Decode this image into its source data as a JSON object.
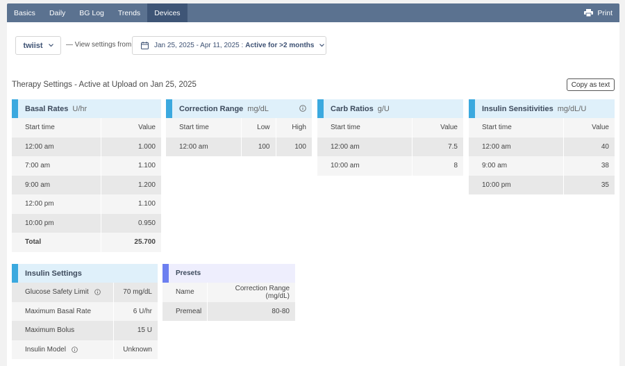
{
  "nav": {
    "tabs": [
      {
        "label": "Basics"
      },
      {
        "label": "Daily"
      },
      {
        "label": "BG Log"
      },
      {
        "label": "Trends"
      },
      {
        "label": "Devices",
        "active": true
      }
    ],
    "print_label": "Print"
  },
  "filters": {
    "pump": "twiist",
    "view_from_label": "— View settings from",
    "date_range": "Jan 25, 2025 - Apr 11, 2025 :",
    "active_label": "Active for >2 months"
  },
  "therapy_title": "Therapy Settings - Active at Upload on Jan 25, 2025",
  "copy_label": "Copy as text",
  "basal": {
    "title": "Basal Rates",
    "unit": "U/hr",
    "headers": [
      "Start time",
      "Value"
    ],
    "rows": [
      {
        "time": "12:00 am",
        "value": "1.000"
      },
      {
        "time": "7:00 am",
        "value": "1.100"
      },
      {
        "time": "9:00 am",
        "value": "1.200"
      },
      {
        "time": "12:00 pm",
        "value": "1.100"
      },
      {
        "time": "10:00 pm",
        "value": "0.950"
      }
    ],
    "total_label": "Total",
    "total_value": "25.700"
  },
  "correction": {
    "title": "Correction Range",
    "unit": "mg/dL",
    "headers": [
      "Start time",
      "Low",
      "High"
    ],
    "rows": [
      {
        "time": "12:00 am",
        "low": "100",
        "high": "100"
      }
    ]
  },
  "carb": {
    "title": "Carb Ratios",
    "unit": "g/U",
    "headers": [
      "Start time",
      "Value"
    ],
    "rows": [
      {
        "time": "12:00 am",
        "value": "7.5"
      },
      {
        "time": "10:00 am",
        "value": "8"
      }
    ]
  },
  "isf": {
    "title": "Insulin Sensitivities",
    "unit": "mg/dL/U",
    "headers": [
      "Start time",
      "Value"
    ],
    "rows": [
      {
        "time": "12:00 am",
        "value": "40"
      },
      {
        "time": "9:00 am",
        "value": "38"
      },
      {
        "time": "10:00 pm",
        "value": "35"
      }
    ]
  },
  "insulin_settings": {
    "title": "Insulin Settings",
    "rows": [
      {
        "label": "Glucose Safety Limit",
        "value": "70 mg/dL",
        "info": true
      },
      {
        "label": "Maximum Basal Rate",
        "value": "6 U/hr"
      },
      {
        "label": "Maximum Bolus",
        "value": "15 U"
      },
      {
        "label": "Insulin Model",
        "value": "Unknown",
        "info": true
      }
    ]
  },
  "presets": {
    "title": "Presets",
    "headers": [
      "Name",
      "Correction Range (mg/dL)"
    ],
    "rows": [
      {
        "name": "Premeal",
        "range": "80-80"
      }
    ]
  },
  "colors": {
    "nav": "#5b7290",
    "nav_active": "#3e5576",
    "accent": "#3ba9df",
    "preset_accent": "#6c7ff0"
  }
}
